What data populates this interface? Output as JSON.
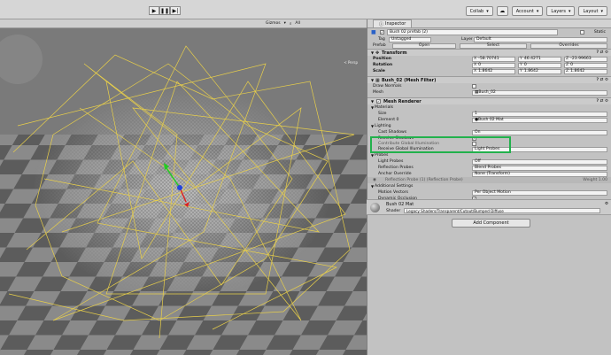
{
  "toolbar": {
    "collab_label": "Collab",
    "account_label": "Account",
    "layers_label": "Layers",
    "layout_label": "Layout",
    "cloud_icon": "cloud-icon"
  },
  "scene": {
    "gizmos_label": "Gizmos",
    "search_label": "All",
    "persp_label": "< Persp"
  },
  "inspector": {
    "tab_label": "Inspector",
    "object_name": "Bush 02 prefab (2)",
    "static_label": "Static",
    "tag_label": "Tag",
    "tag_value": "Untagged",
    "layer_label": "Layer",
    "layer_value": "Default",
    "prefab_label": "Prefab",
    "open_label": "Open",
    "select_label": "Select",
    "overrides_label": "Overrides",
    "transform": {
      "title": "Transform",
      "position_label": "Position",
      "position": {
        "x": "-58.70741",
        "y": "46.4271",
        "z": "-23.99663"
      },
      "rotation_label": "Rotation",
      "rotation": {
        "x": "0",
        "y": "0",
        "z": "0"
      },
      "scale_label": "Scale",
      "scale": {
        "x": "1.8642",
        "y": "1.8642",
        "z": "1.8642"
      }
    },
    "mesh_filter": {
      "title": "Bush_02 (Mesh Filter)",
      "draw_normals_label": "Draw Normals",
      "mesh_label": "Mesh",
      "mesh_value": "Bush_02"
    },
    "mesh_renderer": {
      "title": "Mesh Renderer",
      "materials_label": "Materials",
      "size_label": "Size",
      "size_value": "1",
      "element_label": "Element 0",
      "element_value": "Bush 02 Mat",
      "lighting_label": "Lighting",
      "cast_shadows_label": "Cast Shadows",
      "cast_shadows_value": "On",
      "receive_shadows_label": "Receive Shadows",
      "contribute_gi_label": "Contribute Global Illumination",
      "receive_gi_label": "Receive Global Illumination",
      "receive_gi_value": "Light Probes",
      "probes_label": "Probes",
      "light_probes_label": "Light Probes",
      "light_probes_value": "Off",
      "reflection_probes_label": "Reflection Probes",
      "reflection_probes_value": "Blend Probes",
      "anchor_override_label": "Anchor Override",
      "anchor_override_value": "None (Transform)",
      "reflection_probe_entry": "Reflection Probe (1) (Reflection Probe)",
      "weight_label": "Weight 1.00",
      "additional_label": "Additional Settings",
      "motion_vectors_label": "Motion Vectors",
      "motion_vectors_value": "Per Object Motion",
      "dynamic_occlusion_label": "Dynamic Occlusion"
    },
    "material": {
      "title": "Bush 02 Mat",
      "shader_label": "Shader",
      "shader_value": "Legacy Shaders/Transparent/Cutout/Bumped Diffuse"
    },
    "add_component_label": "Add Component"
  }
}
